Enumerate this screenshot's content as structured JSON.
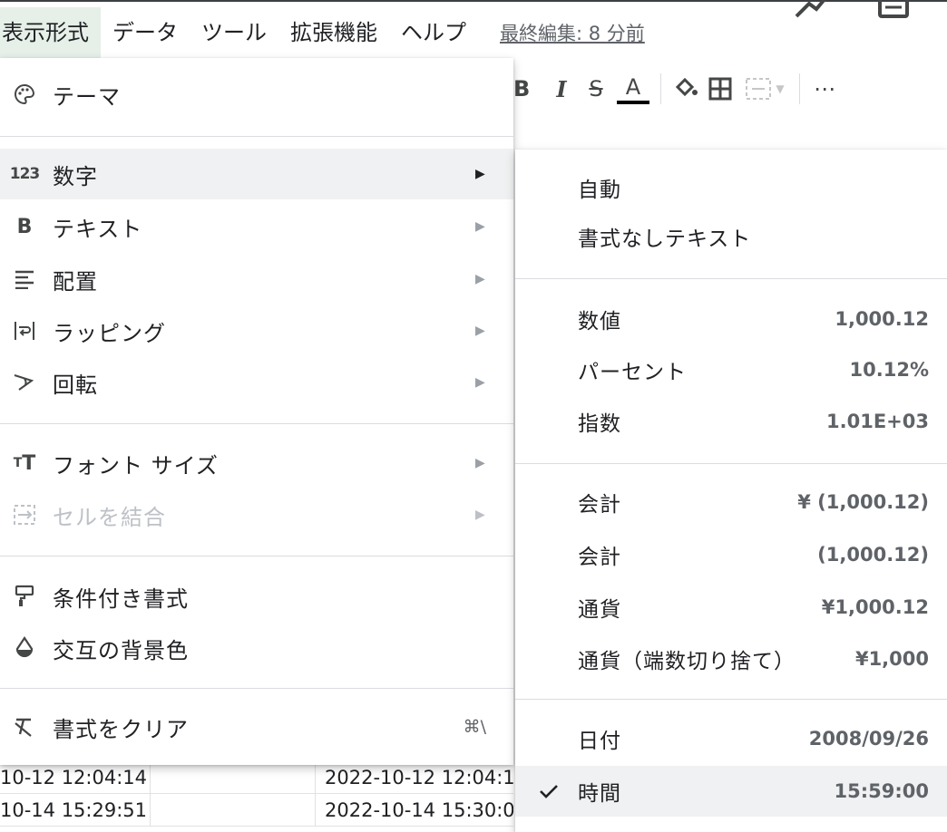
{
  "menubar": {
    "items": [
      {
        "label": "表示形式",
        "active": true
      },
      {
        "label": "データ"
      },
      {
        "label": "ツール"
      },
      {
        "label": "拡張機能"
      },
      {
        "label": "ヘルプ"
      }
    ],
    "last_edit": "最終編集: 8 分前",
    "icons": [
      "trend-icon",
      "comment-icon"
    ]
  },
  "toolbar": {
    "bold": "B",
    "italic": "I",
    "strike": "S",
    "text_color": "A",
    "more": "⋯"
  },
  "format_menu": {
    "items": [
      {
        "label": "テーマ",
        "icon": "palette-icon"
      },
      {
        "label": "数字",
        "icon": "number-123-icon",
        "submenu": true,
        "highlight": true
      },
      {
        "label": "テキスト",
        "icon": "bold-icon",
        "submenu": true
      },
      {
        "label": "配置",
        "icon": "align-icon",
        "submenu": true
      },
      {
        "label": "ラッピング",
        "icon": "wrap-icon",
        "submenu": true
      },
      {
        "label": "回転",
        "icon": "rotate-icon",
        "submenu": true
      },
      {
        "label": "フォント サイズ",
        "icon": "font-size-icon",
        "submenu": true
      },
      {
        "label": "セルを結合",
        "icon": "merge-cells-icon",
        "submenu": true,
        "disabled": true
      },
      {
        "label": "条件付き書式",
        "icon": "paint-roller-icon"
      },
      {
        "label": "交互の背景色",
        "icon": "fill-drop-icon"
      },
      {
        "label": "書式をクリア",
        "icon": "clear-format-icon",
        "shortcut": "⌘\\"
      }
    ]
  },
  "number_submenu": {
    "items": [
      {
        "label": "自動",
        "sample": ""
      },
      {
        "label": "書式なしテキスト",
        "sample": ""
      },
      {
        "label": "数値",
        "sample": "1,000.12"
      },
      {
        "label": "パーセント",
        "sample": "10.12%"
      },
      {
        "label": "指数",
        "sample": "1.01E+03"
      },
      {
        "label": "会計",
        "sample": "¥ (1,000.12)"
      },
      {
        "label": "会計",
        "sample": "(1,000.12)"
      },
      {
        "label": "通貨",
        "sample": "¥1,000.12"
      },
      {
        "label": "通貨（端数切り捨て）",
        "sample": "¥1,000"
      },
      {
        "label": "日付",
        "sample": "2008/09/26"
      },
      {
        "label": "時間",
        "sample": "15:59:00",
        "checked": true,
        "highlight": true
      }
    ]
  },
  "sheet": {
    "rows": [
      {
        "a": "10-12 12:04:14",
        "c": "2022-10-12 12:04:1"
      },
      {
        "a": "10-14 15:29:51",
        "c": "2022-10-14 15:30:0"
      }
    ]
  },
  "colors": {
    "active_menu_bg": "#e6f0e9",
    "hover_bg": "#f0f1f2",
    "divider": "#dadce0",
    "text": "#202124",
    "muted": "#5f6368",
    "disabled": "#bdc1c6"
  }
}
